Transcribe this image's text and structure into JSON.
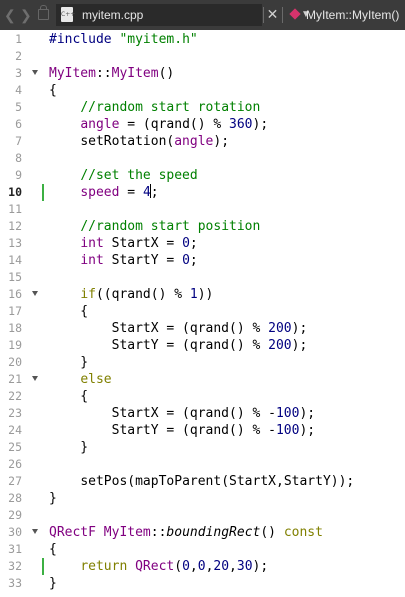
{
  "tab": {
    "filename": "myitem.cpp",
    "file_icon_label": "C++",
    "symbol": "MyItem::MyItem()"
  },
  "icons": {
    "back": "chevron-left-icon",
    "forward": "chevron-right-icon",
    "lock": "lock-icon",
    "dropdown": "chevron-down-icon",
    "close": "close-icon",
    "symbol": "function-symbol-icon"
  },
  "colors": {
    "toolbar_bg": "#3b3b3b",
    "keyword": "#808000",
    "type": "#800080",
    "comment": "#008000",
    "number": "#000080",
    "modified_marker": "#3cb043"
  },
  "lines": [
    {
      "n": "1",
      "text": "#include \"myitem.h\""
    },
    {
      "n": "2",
      "text": ""
    },
    {
      "n": "3",
      "text": "MyItem::MyItem()",
      "fold": true
    },
    {
      "n": "4",
      "text": "{"
    },
    {
      "n": "5",
      "text": "    //random start rotation"
    },
    {
      "n": "6",
      "text": "    angle = (qrand() % 360);"
    },
    {
      "n": "7",
      "text": "    setRotation(angle);"
    },
    {
      "n": "8",
      "text": ""
    },
    {
      "n": "9",
      "text": "    //set the speed"
    },
    {
      "n": "10",
      "text": "    speed = 4;",
      "current": true,
      "modified": true
    },
    {
      "n": "11",
      "text": ""
    },
    {
      "n": "12",
      "text": "    //random start position"
    },
    {
      "n": "13",
      "text": "    int StartX = 0;"
    },
    {
      "n": "14",
      "text": "    int StartY = 0;"
    },
    {
      "n": "15",
      "text": ""
    },
    {
      "n": "16",
      "text": "    if((qrand() % 1))",
      "fold": true
    },
    {
      "n": "17",
      "text": "    {"
    },
    {
      "n": "18",
      "text": "        StartX = (qrand() % 200);"
    },
    {
      "n": "19",
      "text": "        StartY = (qrand() % 200);"
    },
    {
      "n": "20",
      "text": "    }"
    },
    {
      "n": "21",
      "text": "    else",
      "fold": true
    },
    {
      "n": "22",
      "text": "    {"
    },
    {
      "n": "23",
      "text": "        StartX = (qrand() % -100);"
    },
    {
      "n": "24",
      "text": "        StartY = (qrand() % -100);"
    },
    {
      "n": "25",
      "text": "    }"
    },
    {
      "n": "26",
      "text": ""
    },
    {
      "n": "27",
      "text": "    setPos(mapToParent(StartX,StartY));"
    },
    {
      "n": "28",
      "text": "}"
    },
    {
      "n": "29",
      "text": ""
    },
    {
      "n": "30",
      "text": "QRectF MyItem::boundingRect() const",
      "fold": true
    },
    {
      "n": "31",
      "text": "{"
    },
    {
      "n": "32",
      "text": "    return QRect(0,0,20,30);",
      "modified": true
    },
    {
      "n": "33",
      "text": "}"
    }
  ]
}
